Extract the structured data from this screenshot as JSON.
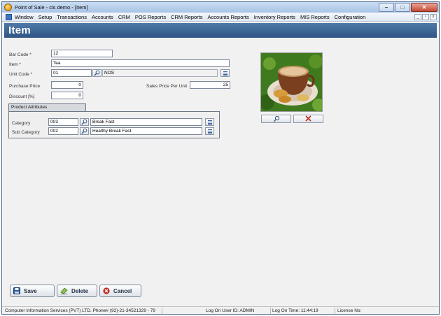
{
  "window": {
    "title": "Point of Sale - cis demo - [Item]",
    "controls": {
      "minimize": "–",
      "maximize": "□",
      "close": "✕"
    }
  },
  "menu": {
    "items": [
      "Window",
      "Setup",
      "Transactions",
      "Accounts",
      "CRM",
      "POS Reports",
      "CRM Reports",
      "Accounts Reports",
      "Inventory Reports",
      "MIS Reports",
      "Configuration"
    ],
    "mdi_controls": {
      "minimize": "_",
      "restore": "▫",
      "close": "x"
    }
  },
  "header": {
    "title": "Item"
  },
  "form": {
    "bar_code": {
      "label": "Bar Code *",
      "value": "12"
    },
    "item": {
      "label": "Item *",
      "value": "Tea"
    },
    "unit_code": {
      "label": "Unit Code *",
      "value": "01",
      "description": "NOS"
    },
    "purchase_price": {
      "label": "Purchase Price",
      "value": "0"
    },
    "sales_price": {
      "label": "Sales Price Per Unit",
      "value": "25"
    },
    "discount": {
      "label": "Discount [%]",
      "value": "0"
    }
  },
  "product_attributes": {
    "title": "Product Attributes",
    "category": {
      "label": "Category",
      "code": "003",
      "description": "Break Fast"
    },
    "sub_category": {
      "label": "Sub Category",
      "code": "002",
      "description": "Healthy Break Fast"
    }
  },
  "buttons": {
    "save": "Save",
    "delete": "Delete",
    "cancel": "Cancel"
  },
  "status": {
    "company": "Computer Information Services (PVT) LTD. Phone# (92)-21-34521329 - 79",
    "user": "Log On User ID: ADMIN",
    "time": "Log On Time: 11:44:19",
    "license": "License No:"
  },
  "colors": {
    "header": "#3a6394",
    "accent_red": "#c0271f"
  }
}
